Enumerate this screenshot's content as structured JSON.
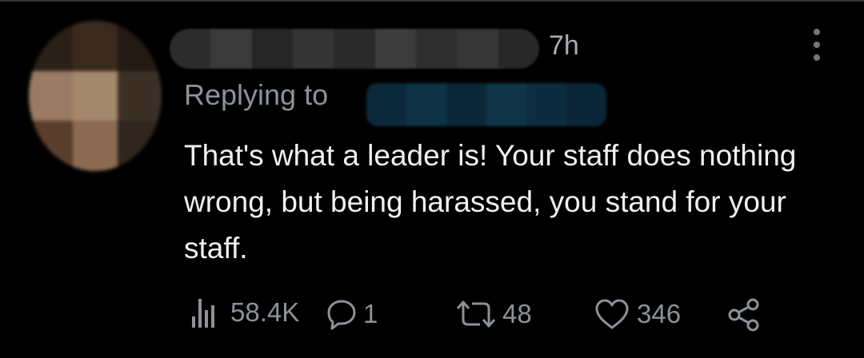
{
  "tweet": {
    "time": "7h",
    "replying_label": "Replying to",
    "text": "That's what a leader is! Your staff does nothing wrong, but being harassed, you stand for your staff."
  },
  "actions": {
    "views": "58.4K",
    "replies": "1",
    "retweets": "48",
    "likes": "346"
  },
  "icons": [
    "views-icon",
    "reply-icon",
    "retweet-icon",
    "like-icon",
    "share-icon",
    "more-options-icon"
  ],
  "colors": {
    "background": "#000000",
    "text": "#e7e9ea",
    "secondary_text": "#8b9298"
  }
}
